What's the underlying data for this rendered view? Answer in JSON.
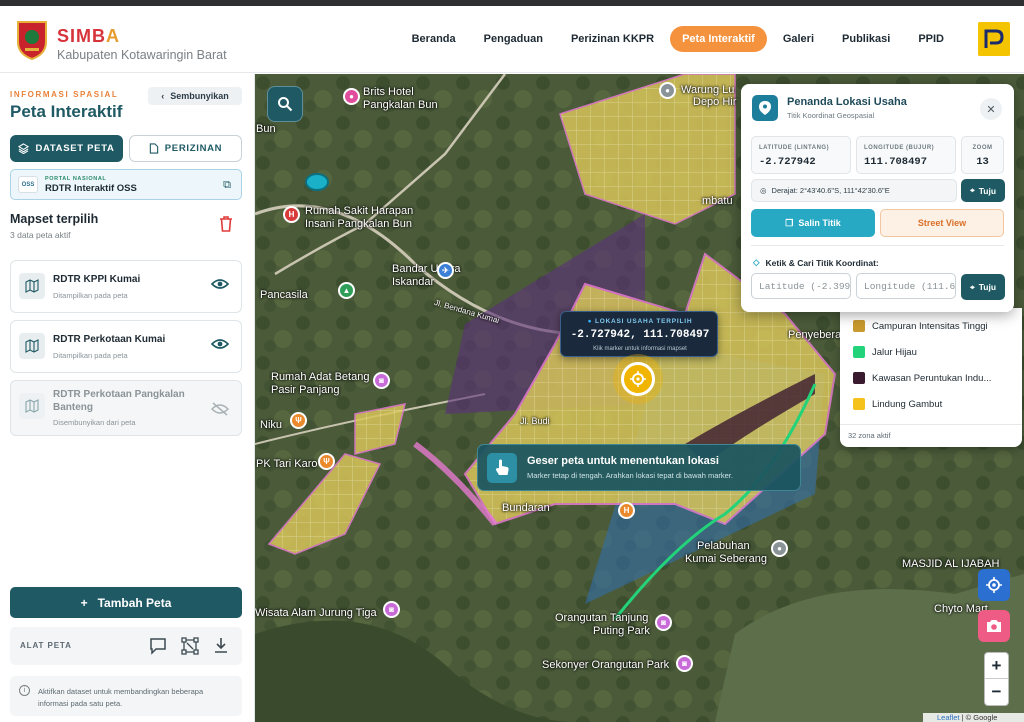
{
  "header": {
    "brand_s": "SIMB",
    "brand_a": "A",
    "subtitle": "Kabupaten Kotawaringin Barat",
    "nav": [
      {
        "label": "Beranda",
        "active": false
      },
      {
        "label": "Pengaduan",
        "active": false
      },
      {
        "label": "Perizinan KKPR",
        "active": false
      },
      {
        "label": "Peta Interaktif",
        "active": true
      },
      {
        "label": "Galeri",
        "active": false
      },
      {
        "label": "Publikasi",
        "active": false
      },
      {
        "label": "PPID",
        "active": false
      }
    ]
  },
  "sidebar": {
    "kicker": "INFORMASI SPASIAL",
    "title": "Peta Interaktif",
    "hide_label": "Sembunyikan",
    "tab_dataset": "DATASET PETA",
    "tab_perizinan": "PERIZINAN",
    "oss_kicker": "PORTAL NASIONAL",
    "oss_title": "RDTR Interaktif OSS",
    "oss_badge": "OSS",
    "mapset_title": "Mapset terpilih",
    "mapset_sub": "3 data peta aktif",
    "layers": [
      {
        "name": "RDTR KPPI Kumai",
        "status": "Ditampilkan pada peta",
        "visible": true
      },
      {
        "name": "RDTR Perkotaan Kumai",
        "status": "Ditampilkan pada peta",
        "visible": true
      },
      {
        "name": "RDTR Perkotaan Pangkalan Banteng",
        "status": "Disembunyikan dari peta",
        "visible": false
      }
    ],
    "add_label": "Tambah Peta",
    "tools_label": "ALAT PETA",
    "info_text": "Aktifkan dataset untuk membandingkan beberapa informasi pada satu peta."
  },
  "map": {
    "labels": [
      "Brits Hotel",
      "Pangkalan Bun",
      "Warung Lu",
      "Depo Hir",
      "Rumah Sakit Harapan",
      "Insani Pangkalan Bun",
      "Bandar Udara",
      "Iskandar",
      "Jl. Bendana Kumai",
      "Penyeberangan",
      "Rumah Adat Betang",
      "Pasir Panjang",
      "Pelabuhan",
      "Kumai Seberang",
      "MASJID AL IJABAH",
      "Chyto Mart",
      "Orangutan Tanjung",
      "Puting Park",
      "Sekonyer Orangutan Park",
      "Wisata Alam Jurung Tiga",
      "Pancasila",
      "Bun",
      "Niku",
      "PK Tari Karo",
      "Jl. Budi",
      "Bundaran",
      "mbatu"
    ],
    "selected": {
      "kicker": "LOKASI USAHA TERPILIH",
      "coords": "-2.727942, 111.708497",
      "hint": "Klik marker untuk informasi mapset"
    },
    "toast": {
      "title": "Geser peta untuk menentukan lokasi",
      "subtitle": "Marker tetap di tengah. Arahkan lokasi tepat di bawah marker."
    },
    "attribution_leaflet": "Leaflet",
    "attribution_rest": " | © Google"
  },
  "popup": {
    "title": "Penanda Lokasi Usaha",
    "subtitle": "Titik Koordinat Geospasial",
    "lat_label": "LATITUDE (LINTANG)",
    "lat_value": "-2.727942",
    "lon_label": "LONGITUDE (BUJUR)",
    "lon_value": "111.708497",
    "zoom_label": "ZOOM",
    "zoom_value": "13",
    "dms": "Derajat: 2°43'40.6\"S, 111°42'30.6\"E",
    "go_label": "Tuju",
    "copy_label": "Salin Titik",
    "streetview_label": "Street View",
    "find_label": "Ketik & Cari Titik Koordinat:",
    "lat_placeholder": "Latitude (-2.399",
    "lon_placeholder": "Longitude (111.6"
  },
  "legend": {
    "items": [
      {
        "label": "Campuran Intensitas Tinggi",
        "color": "#c79a2e"
      },
      {
        "label": "Jalur Hijau",
        "color": "#23d37a"
      },
      {
        "label": "Kawasan Peruntukan Indu...",
        "color": "#3a1a2e"
      },
      {
        "label": "Lindung Gambut",
        "color": "#f4c21a"
      }
    ],
    "count": "32 zona aktif"
  },
  "colors": {
    "primary": "#1f5a64",
    "accent": "#f5923e",
    "brand_red": "#d6333a"
  }
}
